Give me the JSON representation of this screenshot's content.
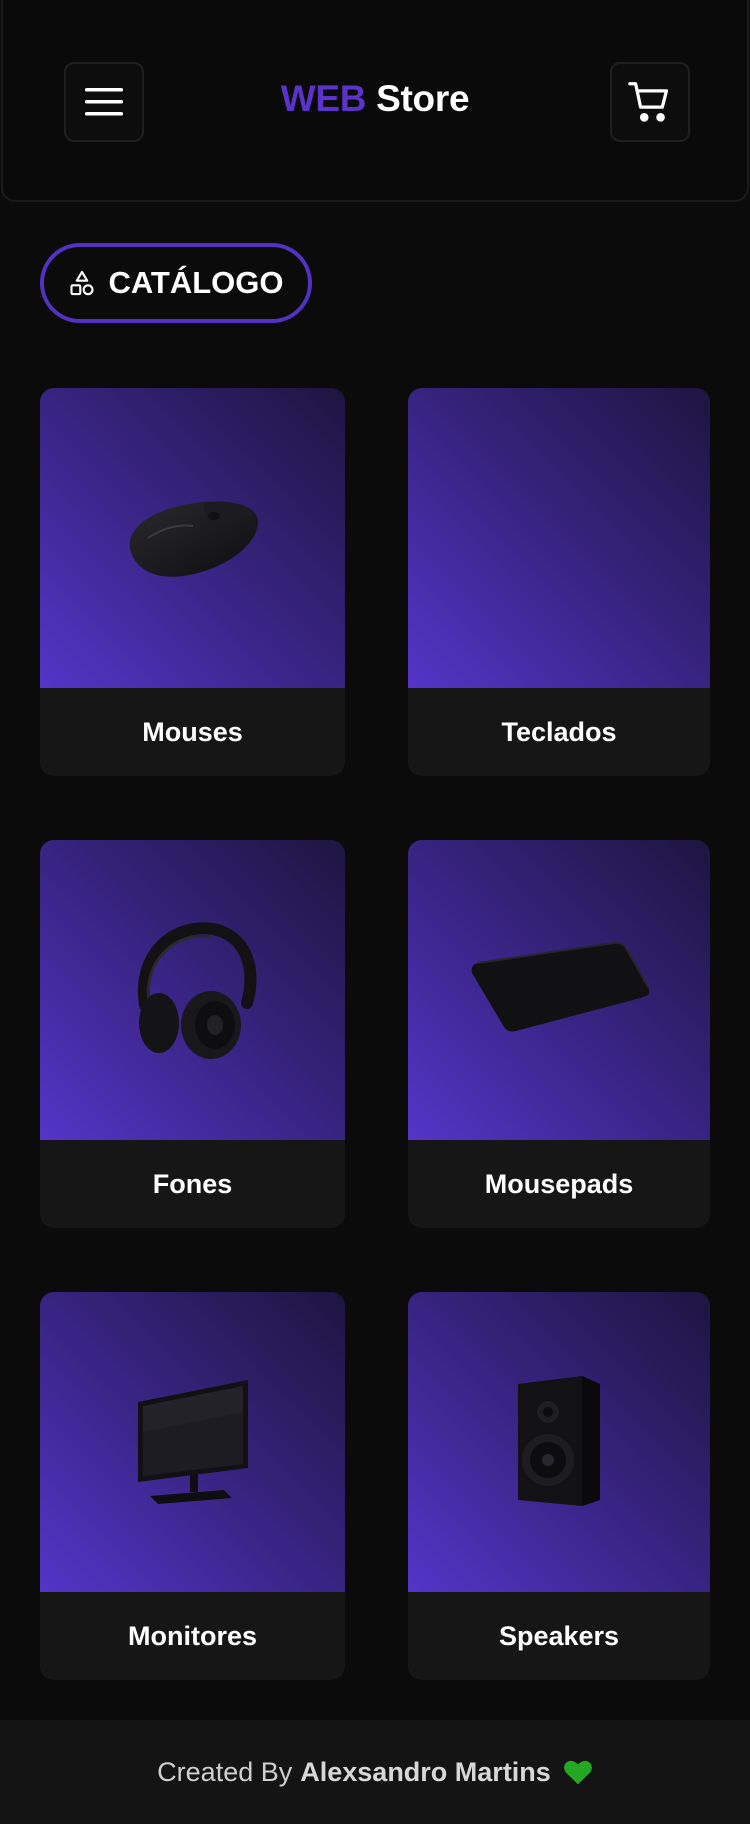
{
  "header": {
    "brand_accent": "WEB",
    "brand_rest": "Store",
    "menu_icon": "hamburger-menu-icon",
    "cart_icon": "shopping-cart-icon"
  },
  "catalog": {
    "label": "CATÁLOGO",
    "icon": "shapes-icon"
  },
  "categories": [
    {
      "label": "Mouses",
      "image": "mouse"
    },
    {
      "label": "Teclados",
      "image": ""
    },
    {
      "label": "Fones",
      "image": "headphones"
    },
    {
      "label": "Mousepads",
      "image": "mousepad"
    },
    {
      "label": "Monitores",
      "image": "monitor"
    },
    {
      "label": "Speakers",
      "image": "speaker"
    }
  ],
  "footer": {
    "prefix": "Created By",
    "author": "Alexsandro Martins",
    "heart_color": "#22a822"
  },
  "colors": {
    "accent": "#5b33c9",
    "background": "#0b0b0b",
    "card_label_bg": "#161616"
  }
}
